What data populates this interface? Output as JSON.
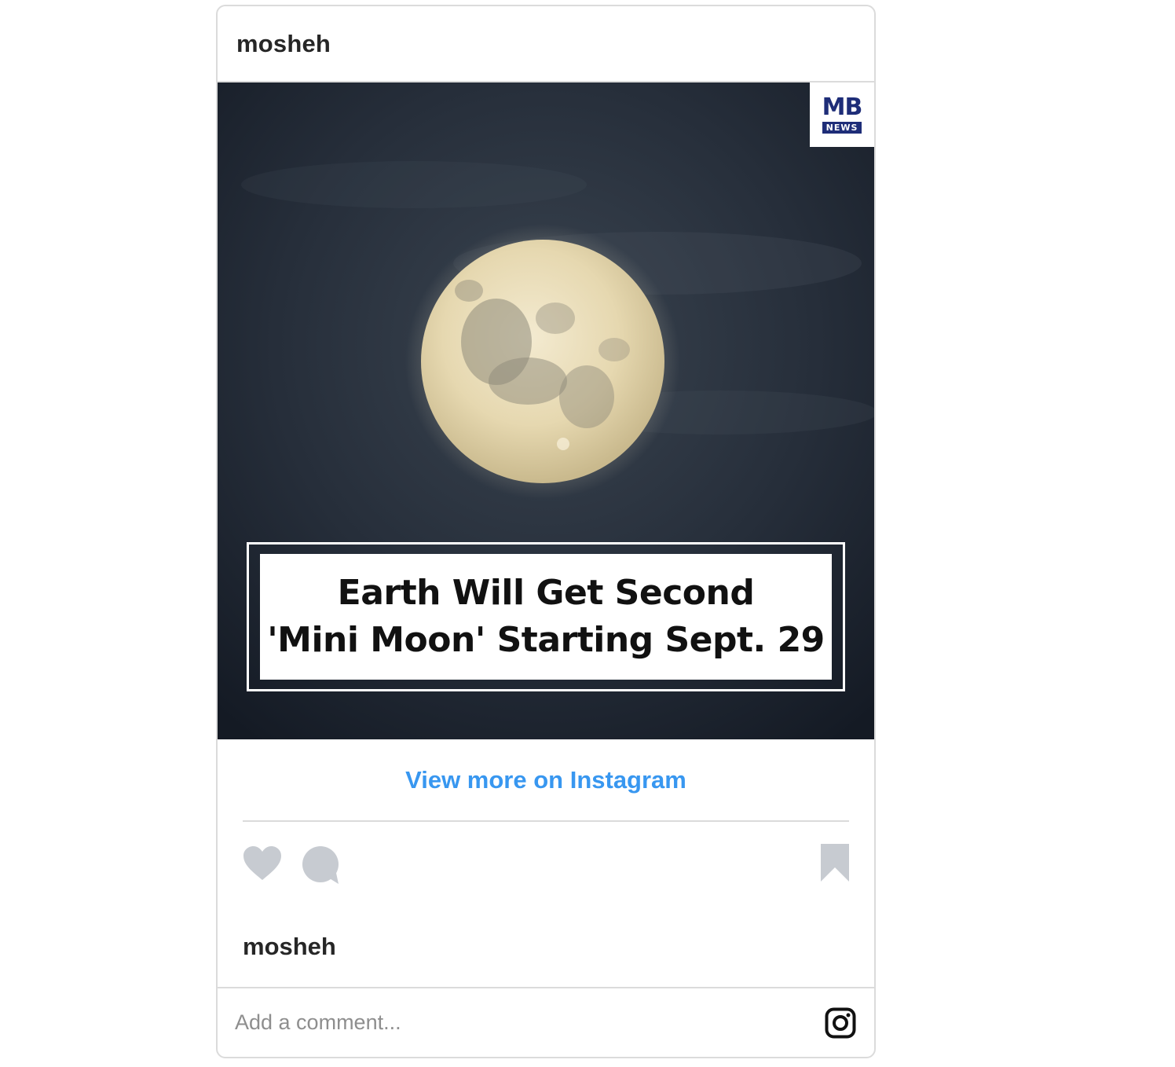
{
  "post": {
    "username": "mosheh",
    "media": {
      "headline_line1": "Earth Will Get Second",
      "headline_line2": "'Mini Moon' Starting Sept. 29",
      "logo_mark": "MB",
      "logo_sub": "NEWS"
    },
    "view_more_label": "View more on Instagram",
    "owner": "mosheh",
    "comment_placeholder": "Add a comment..."
  },
  "icons": {
    "like": "heart-icon",
    "comment": "comment-icon",
    "save": "bookmark-icon",
    "brand": "instagram-icon"
  },
  "colors": {
    "link": "#3897f0",
    "icon_gray": "#c7cbd1",
    "border": "#dbdbdb",
    "text": "#262626",
    "logo_navy": "#1e2d78"
  }
}
